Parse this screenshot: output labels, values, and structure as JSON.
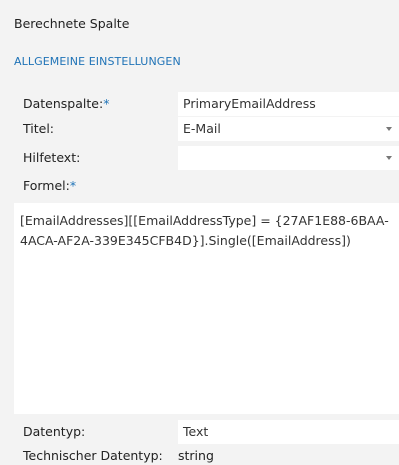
{
  "panel": {
    "title": "Berechnete Spalte"
  },
  "tabs": [
    {
      "label": "ALLGEMEINE EINSTELLUNGEN"
    }
  ],
  "fields": {
    "datenspalte": {
      "label": "Datenspalte:",
      "required_marker": "*",
      "value": "PrimaryEmailAddress"
    },
    "titel": {
      "label": "Titel:",
      "value": "E-Mail"
    },
    "hilfetext": {
      "label": "Hilfetext:",
      "value": ""
    },
    "formel": {
      "label": "Formel:",
      "required_marker": "*",
      "value": "[EmailAddresses][[EmailAddressType] = {27AF1E88-6BAA-\n4ACA-AF2A-339E345CFB4D}].Single([EmailAddress])"
    },
    "datentyp": {
      "label": "Datentyp:",
      "value": "Text"
    },
    "technischer_datentyp": {
      "label": "Technischer Datentyp:",
      "value": "string"
    }
  },
  "colors": {
    "accent": "#1f73b7",
    "background": "#f3f3f3",
    "field": "#ffffff"
  }
}
